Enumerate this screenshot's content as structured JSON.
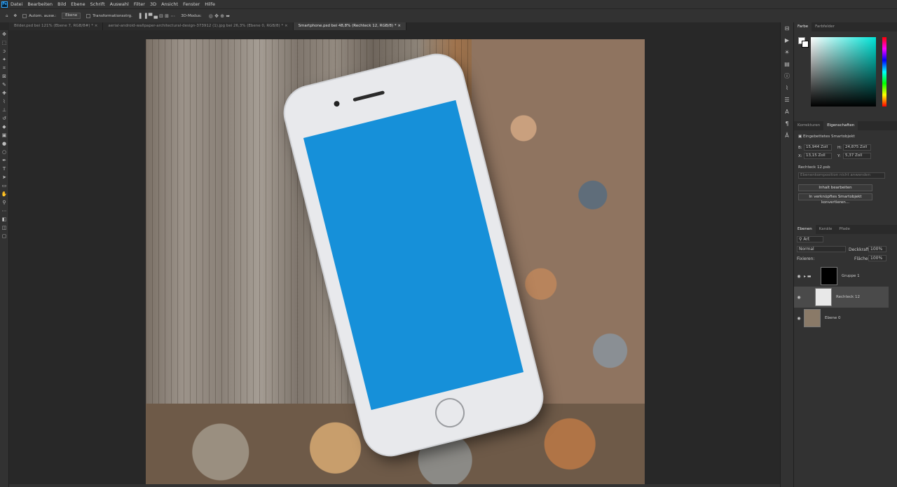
{
  "menu": {
    "logo": "Ps",
    "items": [
      "Datei",
      "Bearbeiten",
      "Bild",
      "Ebene",
      "Schrift",
      "Auswahl",
      "Filter",
      "3D",
      "Ansicht",
      "Fenster",
      "Hilfe"
    ]
  },
  "options": {
    "autoselect": "Autom. ausw.:",
    "layer_select": "Ebene",
    "transform": "Transformationsstrg.",
    "mode_3d": "3D-Modus:"
  },
  "tabs": [
    {
      "label": "Bilder.psd bei 121% (Ebene 7, RGB/8#) *",
      "active": false
    },
    {
      "label": "aerial-android-wallpaper-architectural-design-373912 (1).jpg bei 26,3% (Ebene 0, RGB/8) *",
      "active": false
    },
    {
      "label": "Smartphone.psd bei 48,8% (Rechteck 12, RGB/8) *",
      "active": true
    }
  ],
  "tools": [
    "move-icon",
    "marquee-icon",
    "lasso-icon",
    "magic-wand-icon",
    "crop-icon",
    "frame-icon",
    "eyedropper-icon",
    "healing-icon",
    "brush-icon",
    "stamp-icon",
    "history-brush-icon",
    "eraser-icon",
    "gradient-icon",
    "blur-icon",
    "dodge-icon",
    "pen-icon",
    "type-icon",
    "path-select-icon",
    "shape-icon",
    "hand-icon",
    "zoom-icon",
    "more-icon",
    "color-swatch-icon",
    "quickmask-icon",
    "screenmode-icon"
  ],
  "color_panel": {
    "tab_color": "Farbe",
    "tab_swatches": "Farbfelder"
  },
  "properties": {
    "tab_corrections": "Korrekturen",
    "tab_properties": "Eigenschaften",
    "type": "Eingebettetes Smartobjekt",
    "w_label": "B:",
    "w": "15,944 Zoll",
    "h_label": "H:",
    "h": "24,875 Zoll",
    "x_label": "X:",
    "x": "13,15 Zoll",
    "y_label": "Y:",
    "y": "5,37 Zoll",
    "file": "Rechteck 12.psb",
    "comp": "Ebenenkomposition nicht anwenden",
    "edit_btn": "Inhalt bearbeiten",
    "convert_btn": "In verknüpftes Smartobjekt konvertieren..."
  },
  "layers_panel": {
    "tab_layers": "Ebenen",
    "tab_channels": "Kanäle",
    "tab_paths": "Pfade",
    "filter": "Art",
    "blend": "Normal",
    "opacity_label": "Deckkraft:",
    "opacity": "100%",
    "lock_label": "Fixieren:",
    "fill_label": "Fläche:",
    "fill": "100%",
    "layers": [
      {
        "name": "Gruppe 1"
      },
      {
        "name": "Rechteck 12"
      },
      {
        "name": "Ebene 0"
      }
    ]
  }
}
